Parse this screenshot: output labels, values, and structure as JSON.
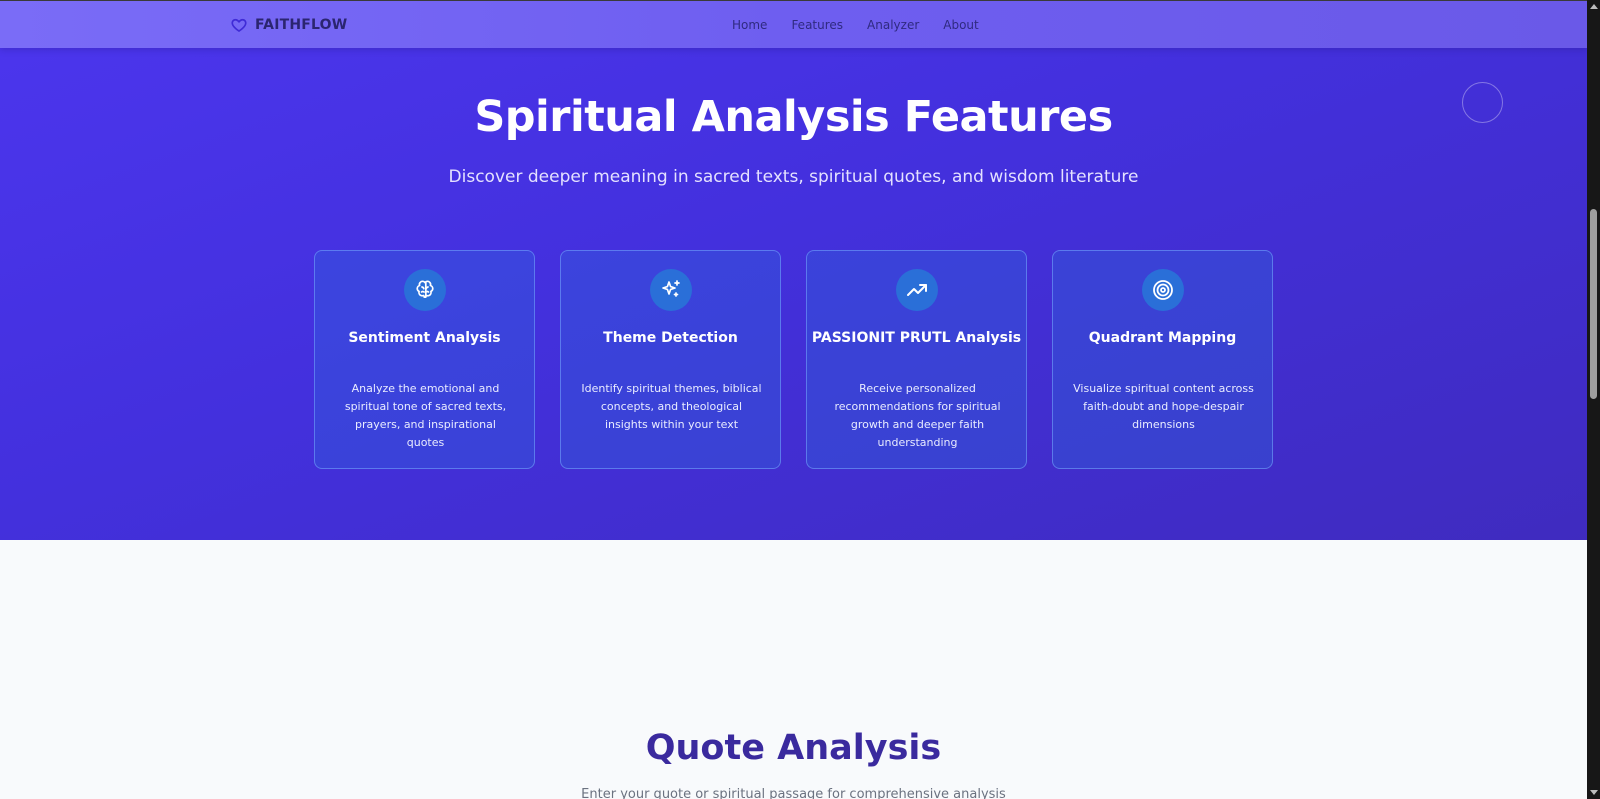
{
  "navbar": {
    "brand_icon": "heart-icon",
    "brand_name": "FAITHFLOW",
    "links": [
      {
        "label": "Home"
      },
      {
        "label": "Features"
      },
      {
        "label": "Analyzer"
      },
      {
        "label": "About"
      }
    ]
  },
  "hero": {
    "title": "Spiritual Analysis Features",
    "subtitle": "Discover deeper meaning in sacred texts, spiritual quotes, and wisdom literature",
    "cards": [
      {
        "icon": "brain-icon",
        "title": "Sentiment Analysis",
        "description": "Analyze the emotional and spiritual tone of sacred texts, prayers, and inspirational quotes"
      },
      {
        "icon": "sparkles-icon",
        "title": "Theme Detection",
        "description": "Identify spiritual themes, biblical concepts, and theological insights within your text"
      },
      {
        "icon": "trending-up-icon",
        "title": "PASSIONIT PRUTL Analysis",
        "description": "Receive personalized recommendations for spiritual growth and deeper faith understanding"
      },
      {
        "icon": "target-icon",
        "title": "Quadrant Mapping",
        "description": "Visualize spiritual content across faith-doubt and hope-despair dimensions"
      }
    ]
  },
  "analyzer_section": {
    "title": "Quote Analysis",
    "subtitle": "Enter your quote or spiritual passage for comprehensive analysis"
  },
  "colors": {
    "hero_gradient_start": "#4c36ee",
    "hero_gradient_end": "#3f2bbf",
    "navbar": "#7264f2",
    "icon_circle": "#2a6fd8",
    "section_title": "#3a2a9e",
    "page_background": "#f8fafc"
  }
}
